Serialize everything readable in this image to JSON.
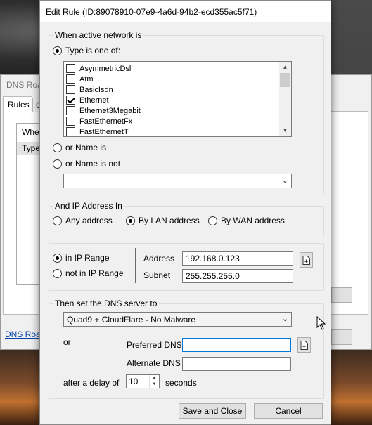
{
  "background_window": {
    "title": "DNS Roa",
    "tab_rules": "Rules",
    "tab_other": "C",
    "column_when": "Whe",
    "column_type": "Type",
    "link": "DNS Roa"
  },
  "dialog": {
    "title": "Edit Rule (ID:89078910-07e9-4a6d-94b2-ecd355ac5f71)",
    "network_group": {
      "label": "When active network is",
      "type_is_one_of": "Type is one of:",
      "type_selected": true,
      "types": [
        {
          "label": "AsymmetricDsl",
          "checked": false
        },
        {
          "label": "Atm",
          "checked": false
        },
        {
          "label": "BasicIsdn",
          "checked": false
        },
        {
          "label": "Ethernet",
          "checked": true
        },
        {
          "label": "Ethernet3Megabit",
          "checked": false
        },
        {
          "label": "FastEthernetFx",
          "checked": false
        },
        {
          "label": "FastEthernetT",
          "checked": false
        }
      ],
      "or_name_is": "or Name is",
      "or_name_is_not": "or Name is not",
      "name_value": ""
    },
    "ip_group": {
      "label": "And IP Address In",
      "options": [
        "Any address",
        "By LAN address",
        "By WAN address"
      ],
      "selected": "By LAN address"
    },
    "range_group": {
      "in_range": "in IP Range",
      "not_in_range": "not in IP Range",
      "selected": "in IP Range",
      "address_label": "Address",
      "address_value": "192.168.0.123",
      "subnet_label": "Subnet",
      "subnet_value": "255.255.255.0"
    },
    "dns_group": {
      "label": "Then set the DNS server to",
      "server": "Quad9 + CloudFlare - No Malware",
      "or": "or",
      "preferred_label": "Preferred DNS",
      "preferred_value": "",
      "alternate_label": "Alternate DNS",
      "alternate_value": "",
      "delay_label": "after a delay of",
      "delay_value": "10",
      "delay_unit": "seconds"
    },
    "buttons": {
      "save": "Save and Close",
      "cancel": "Cancel"
    }
  }
}
